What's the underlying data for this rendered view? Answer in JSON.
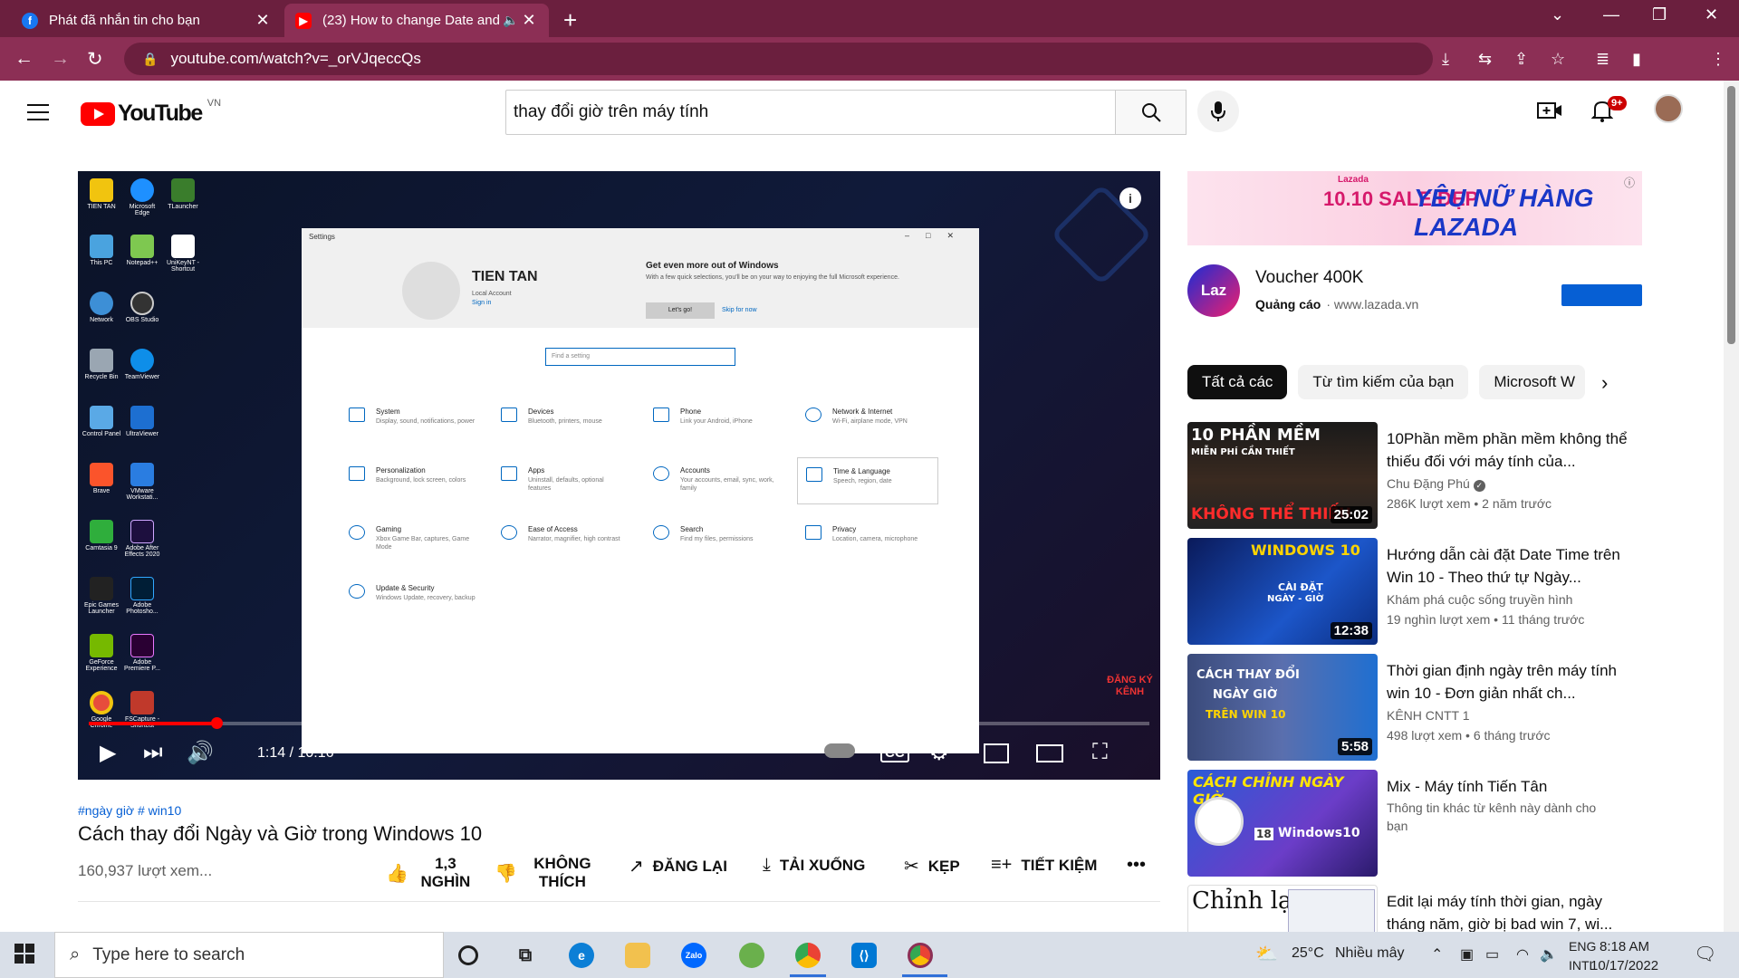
{
  "browser": {
    "tabs": [
      {
        "title": "Phát đã nhắn tin cho bạn",
        "icon": "facebook-icon"
      },
      {
        "title": "(23) How to change Date and",
        "icon": "youtube-icon"
      }
    ],
    "url": "youtube.com/watch?v=_orVJqeccQs"
  },
  "youtube": {
    "logo_text": "YouTube",
    "country_code": "VN",
    "search_value": "thay đổi giờ trên máy tính",
    "notifications": "9+"
  },
  "video": {
    "time": "1:14 / 10:16",
    "progress_fraction": 0.12,
    "tags": "#ngày giờ # win10",
    "title": "Cách thay đổi Ngày và Giờ trong Windows 10",
    "views": "160,937 lượt xem...",
    "actions": [
      {
        "label": "1,3 NGHÌN",
        "icon": "thumb-up-icon"
      },
      {
        "label": "KHÔNG THÍCH",
        "icon": "thumb-down-icon"
      },
      {
        "label": "ĐĂNG LẠI",
        "icon": "share-icon"
      },
      {
        "label": "TẢI XUỐNG",
        "icon": "download-icon"
      },
      {
        "label": "KẸP",
        "icon": "scissors-icon"
      },
      {
        "label": "TIẾT KIỆM",
        "icon": "playlist-add-icon"
      }
    ],
    "frame": {
      "settings_title": "Settings",
      "user_name": "TIEN TAN",
      "account_type": "Local Account",
      "sign_in": "Sign in",
      "promo_title": "Get even more out of Windows",
      "promo_text": "With a few quick selections, you'll be on your way to enjoying the full Microsoft experience.",
      "lets_go": "Let's go!",
      "skip": "Skip for now",
      "find_placeholder": "Find a setting",
      "items": [
        {
          "name": "System",
          "desc": "Display, sound, notifications, power"
        },
        {
          "name": "Devices",
          "desc": "Bluetooth, printers, mouse"
        },
        {
          "name": "Phone",
          "desc": "Link your Android, iPhone"
        },
        {
          "name": "Network & Internet",
          "desc": "Wi-Fi, airplane mode, VPN"
        },
        {
          "name": "Personalization",
          "desc": "Background, lock screen, colors"
        },
        {
          "name": "Apps",
          "desc": "Uninstall, defaults, optional features"
        },
        {
          "name": "Accounts",
          "desc": "Your accounts, email, sync, work, family"
        },
        {
          "name": "Time & Language",
          "desc": "Speech, region, date"
        },
        {
          "name": "Gaming",
          "desc": "Xbox Game Bar, captures, Game Mode"
        },
        {
          "name": "Ease of Access",
          "desc": "Narrator, magnifier, high contrast"
        },
        {
          "name": "Search",
          "desc": "Find my files, permissions"
        },
        {
          "name": "Privacy",
          "desc": "Location, camera, microphone"
        },
        {
          "name": "Update & Security",
          "desc": "Windows Update, recovery, backup"
        }
      ],
      "desktop_icons": [
        "TIEN TAN",
        "Microsoft Edge",
        "TLauncher",
        "This PC",
        "Notepad++",
        "UniKeyNT - Shortcut",
        "Network",
        "OBS Studio",
        "Recycle Bin",
        "TeamViewer",
        "Control Panel",
        "UltraViewer",
        "Brave",
        "VMware Workstati...",
        "Camtasia 9",
        "Adobe After Effects 2020",
        "Epic Games Launcher",
        "Adobe Photosho...",
        "GeForce Experience",
        "Adobe Premiere P...",
        "Google Chrome",
        "FSCapture - Shortcut"
      ],
      "channel_watermark": "ĐĂNG KÝ KÊNH"
    }
  },
  "ad": {
    "banner_lazada_label": "Lazada",
    "banner_sale": "10.10 SALE ĐẸP",
    "banner_tagline": "YÊU NỮ HÀNG LAZADA",
    "title": "Voucher 400K",
    "sponsored": "Quảng cáo",
    "domain": "www.lazada.vn",
    "logo_text": "Laz"
  },
  "chips": [
    "Tất cả các",
    "Từ tìm kiếm của bạn",
    "Microsoft W"
  ],
  "recommendations": [
    {
      "title": "10Phần mềm phần mềm không thể thiếu đối với máy tính của...",
      "channel": "Chu Đặng Phú",
      "verified": true,
      "meta": "286K lượt xem • 2 năm trước",
      "duration": "25:02",
      "thumb_text_top": "10 PHẦN MỀM",
      "thumb_text_mid": "MIỄN PHÍ CẦN THIẾT",
      "thumb_text_bottom": "KHÔNG THỂ THIẾU"
    },
    {
      "title": "Hướng dẫn cài đặt Date Time trên Win 10 - Theo thứ tự Ngày...",
      "channel": "Khám phá cuộc sống truyền hình",
      "meta": "19 nghìn lượt xem • 11 tháng trước",
      "duration": "12:38",
      "thumb_text_top": "WINDOWS 10",
      "thumb_text_mid": "CÀI ĐẶT",
      "thumb_text_bottom": "NGÀY - GIỜ"
    },
    {
      "title": "Thời gian định ngày trên máy tính win 10 - Đơn giản nhất ch...",
      "channel": "KÊNH CNTT 1",
      "meta": "498 lượt xem • 6 tháng trước",
      "duration": "5:58",
      "thumb_text_top": "CÁCH THAY ĐỔI",
      "thumb_text_mid": "NGÀY GIỜ",
      "thumb_text_bottom": "TRÊN WIN 10"
    },
    {
      "title": "Mix - Máy tính Tiến Tân",
      "channel": "Thông tin khác từ kênh này dành cho",
      "meta": "bạn",
      "duration": "",
      "thumb_text_top": "CÁCH CHỈNH NGÀY GIỜ",
      "thumb_text_mid": "Windows10",
      "thumb_text_bottom": "18"
    },
    {
      "title": "Edit lại máy tính thời gian, ngày tháng năm, giờ bị bad win 7, wi...",
      "thumb_text_top": "Chỉnh lại"
    }
  ],
  "taskbar": {
    "search_placeholder": "Type here to search",
    "weather_temp": "25°C",
    "weather_text": "Nhiều mây",
    "lang_top": "ENG",
    "lang_bottom": "INTL",
    "time": "8:18 AM",
    "date": "10/17/2022"
  }
}
